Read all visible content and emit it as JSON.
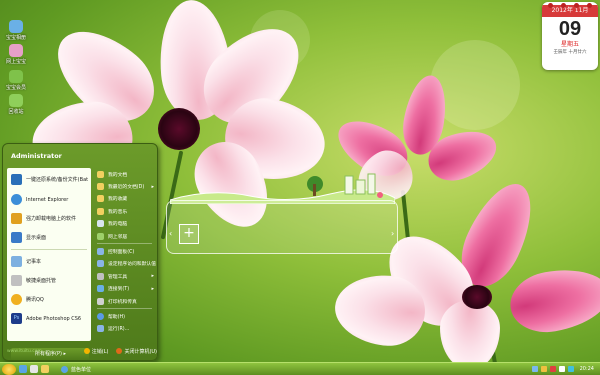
{
  "desktop": {
    "icons": [
      {
        "label": "宝宝相册",
        "color": "#6ab0e6"
      },
      {
        "label": "网上宝宝",
        "color": "#e6a0c8"
      },
      {
        "label": "宝宝会员",
        "color": "#7fc24a"
      },
      {
        "label": "回收站",
        "color": "#8fcf5a"
      }
    ]
  },
  "calendar": {
    "header": "2012年 11月",
    "day": "09",
    "weekday": "星期五",
    "lunar": "壬辰年 十月廿六"
  },
  "start_menu": {
    "user": "Administrator",
    "left_items": [
      {
        "label": "一键还原系统/备份文件(Bat",
        "color": "#2a6fb8"
      },
      {
        "label": "Internet Explorer",
        "color": "#3c8ed8"
      },
      {
        "label": "强力卸载电脑上的软件",
        "color": "#e0a020"
      },
      {
        "label": "显示桌面",
        "color": "#3a7ac8"
      },
      {
        "label": "记事本",
        "color": "#7db0e0"
      },
      {
        "label": "敏捷桌面托管",
        "color": "#c0c0c0"
      },
      {
        "label": "腾讯QQ",
        "color": "#f0b020"
      },
      {
        "label": "Adobe Photoshop CS6",
        "color": "#1d3c8a"
      }
    ],
    "right_items": [
      {
        "label": "我的文档",
        "arrow": ""
      },
      {
        "label": "我最近的文档(D)",
        "arrow": "▸"
      },
      {
        "label": "我的收藏",
        "arrow": ""
      },
      {
        "label": "我的音乐",
        "arrow": ""
      },
      {
        "label": "我的电脑",
        "arrow": ""
      },
      {
        "label": "网上邻居",
        "arrow": ""
      },
      {
        "label": "控制面板(C)",
        "arrow": ""
      },
      {
        "label": "设定程序访问和默认值",
        "arrow": ""
      },
      {
        "label": "管理工具",
        "arrow": "▸"
      },
      {
        "label": "连接到(T)",
        "arrow": "▸"
      },
      {
        "label": "打印机和传真",
        "arrow": ""
      },
      {
        "label": "帮助(H)",
        "arrow": ""
      },
      {
        "label": "运行(R)...",
        "arrow": ""
      }
    ],
    "all_programs": "所有程序(P)",
    "watermark": "www.ituitu.com",
    "logoff": "注销(L)",
    "shutdown": "关闭计算机(U)"
  },
  "taskbar": {
    "task": "蓝色单位",
    "clock": "20:24"
  }
}
